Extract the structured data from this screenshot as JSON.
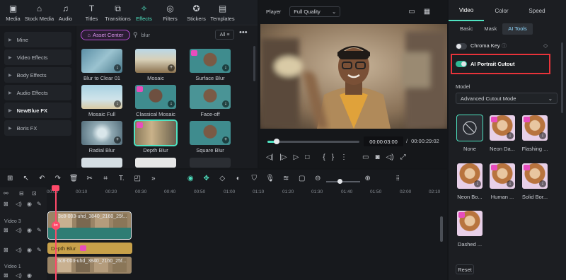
{
  "toolbar": {
    "items": [
      {
        "label": "Media",
        "icon": "media-icon"
      },
      {
        "label": "Stock Media",
        "icon": "stock-media-icon"
      },
      {
        "label": "Audio",
        "icon": "music-note-icon"
      },
      {
        "label": "Titles",
        "icon": "text-icon"
      },
      {
        "label": "Transitions",
        "icon": "transitions-icon"
      },
      {
        "label": "Effects",
        "icon": "effects-sparkle-icon"
      },
      {
        "label": "Filters",
        "icon": "filters-icon"
      },
      {
        "label": "Stickers",
        "icon": "stickers-icon"
      },
      {
        "label": "Templates",
        "icon": "templates-icon"
      }
    ],
    "active": "Effects"
  },
  "categories": [
    {
      "label": "Mine"
    },
    {
      "label": "Video Effects"
    },
    {
      "label": "Body Effects"
    },
    {
      "label": "Audio Effects"
    },
    {
      "label": "NewBlue FX"
    },
    {
      "label": "Boris FX"
    }
  ],
  "effects_panel": {
    "asset_center_label": "Asset Center",
    "search_value": "blur",
    "filter_label": "All",
    "items": [
      {
        "label": "Blur to Clear 01"
      },
      {
        "label": "Mosaic"
      },
      {
        "label": "Surface Blur"
      },
      {
        "label": "Mosaic Full"
      },
      {
        "label": "Classical Mosaic"
      },
      {
        "label": "Face-off"
      },
      {
        "label": "Radial Blur"
      },
      {
        "label": "Depth Blur"
      },
      {
        "label": "Square Blur"
      }
    ],
    "selected": "Depth Blur"
  },
  "player": {
    "label": "Player",
    "quality": "Full Quality",
    "current_time": "00:00:03:00",
    "separator": "/",
    "total_time": "00:00:29:02",
    "progress": 0.1
  },
  "right_panel": {
    "tabs": [
      "Video",
      "Color",
      "Speed"
    ],
    "active_tab": "Video",
    "subtabs": [
      "Basic",
      "Mask",
      "AI Tools"
    ],
    "active_subtab": "AI Tools",
    "chroma_key_label": "Chroma Key",
    "chroma_key_on": false,
    "ai_cutout_label": "AI Portrait Cutout",
    "ai_cutout_on": true,
    "model_label": "Model",
    "model_value": "Advanced Cutout Mode",
    "presets": [
      {
        "label": "None"
      },
      {
        "label": "Neon Da..."
      },
      {
        "label": "Flashing ..."
      },
      {
        "label": "Neon Bo..."
      },
      {
        "label": "Human ..."
      },
      {
        "label": "Solid Bor..."
      },
      {
        "label": "Dashed ..."
      }
    ],
    "reset_label": "Reset"
  },
  "timeline": {
    "ruler": [
      "00:00",
      "00:10",
      "00:20",
      "00:30",
      "00:40",
      "00:50",
      "01:00",
      "01:10",
      "01:20",
      "01:30",
      "01:40",
      "01:50",
      "02:00",
      "02:10"
    ],
    "tracks": [
      {
        "name": "Video 3"
      },
      {
        "name": "Video 1"
      }
    ],
    "clip_video": "3c8-003-uhd_3840_2160_25f...",
    "clip_effect": "Depth Blur",
    "clip_bottom": "3c8-003-uhd_3840_2160_25f..."
  },
  "colors": {
    "accent": "#4fe3c1",
    "highlight_box": "#e8333a",
    "effect_clip": "#c8a14a",
    "video_clip": "#2f7d74"
  }
}
